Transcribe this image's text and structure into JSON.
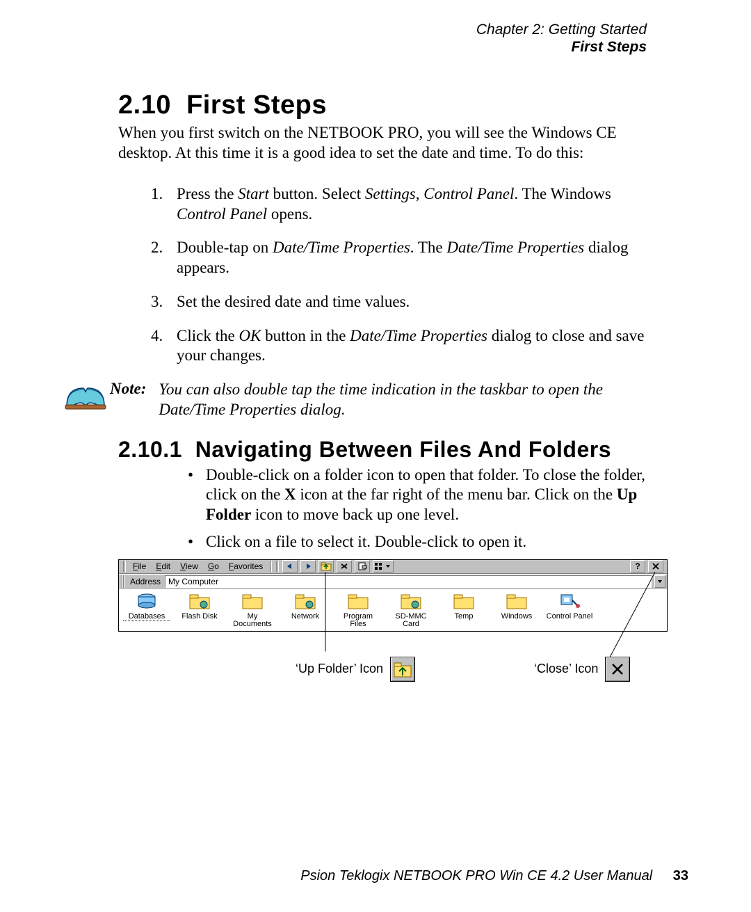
{
  "header": {
    "chapter": "Chapter 2:  Getting Started",
    "section": "First Steps"
  },
  "h2": {
    "num": "2.10",
    "title": "First Steps"
  },
  "intro": "When you first switch on the NETBOOK PRO, you will see the Windows CE desktop. At this time it is a good idea to set the date and time. To do this:",
  "steps": {
    "s1a": "Press the ",
    "s1b": "Start",
    "s1c": " button. Select ",
    "s1d": "Settings",
    "s1e": ", ",
    "s1f": "Control Panel",
    "s1g": ". The Windows ",
    "s1h": "Control Panel",
    "s1i": " opens.",
    "s2a": "Double-tap on ",
    "s2b": "Date/Time Properties",
    "s2c": ". The ",
    "s2d": "Date/Time Properties",
    "s2e": " dialog appears.",
    "s3": "Set the desired date and time values.",
    "s4a": "Click the ",
    "s4b": "OK",
    "s4c": " button in the ",
    "s4d": "Date/Time Properties",
    "s4e": " dialog to close and save your changes."
  },
  "note": {
    "label": "Note:",
    "text": "You can also double tap the time indication in the taskbar to open the Date/Time Properties dialog."
  },
  "h3": {
    "num": "2.10.1",
    "title": "Navigating Between Files And Folders"
  },
  "bullets": {
    "b1a": "Double-click on a folder icon to open that folder. To close the folder, click on the ",
    "b1b": "X",
    "b1c": " icon at the far right of the menu bar. Click on the ",
    "b1d": "Up Folder",
    "b1e": " icon to move back up one level.",
    "b2": "Click on a file to select it. Double-click to open it."
  },
  "explorer": {
    "menus": {
      "file": "File",
      "edit": "Edit",
      "view": "View",
      "go": "Go",
      "fav": "Favorites"
    },
    "address_label": "Address",
    "address_value": "My Computer",
    "items": [
      {
        "label": "Databases",
        "icon": "db"
      },
      {
        "label": "Flash Disk",
        "icon": "folder-sys"
      },
      {
        "label": "My Documents",
        "icon": "folder"
      },
      {
        "label": "Network",
        "icon": "folder-sys"
      },
      {
        "label": "Program Files",
        "icon": "folder"
      },
      {
        "label": "SD-MMC Card",
        "icon": "folder-sys"
      },
      {
        "label": "Temp",
        "icon": "folder"
      },
      {
        "label": "Windows",
        "icon": "folder"
      },
      {
        "label": "Control Panel",
        "icon": "cpl"
      }
    ]
  },
  "callouts": {
    "up": "‘Up Folder’ Icon",
    "close": "‘Close’ Icon"
  },
  "footer": {
    "title": "Psion Teklogix NETBOOK PRO Win CE 4.2 User Manual",
    "page": "33"
  }
}
